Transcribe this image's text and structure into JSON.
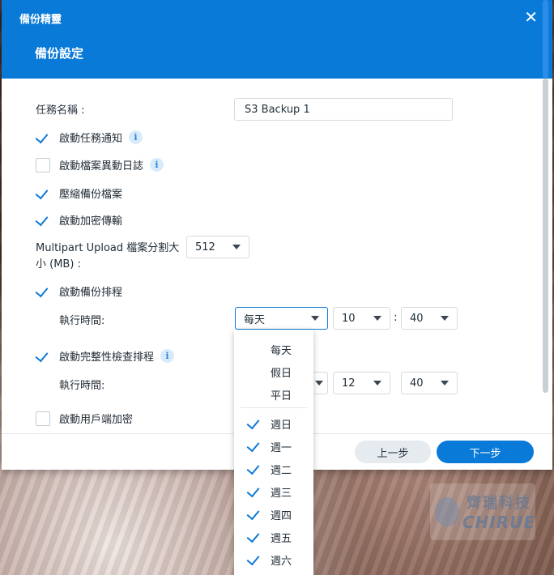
{
  "window": {
    "app_title": "備份精靈",
    "close_glyph": "✕",
    "page_title": "備份設定"
  },
  "form": {
    "task_name_label": "任務名稱 :",
    "task_name_value": "S3 Backup 1",
    "notify_label": "啟動任務通知",
    "file_change_log_label": "啟動檔案異動日誌",
    "compress_label": "壓縮備份檔案",
    "encrypt_transfer_label": "啟動加密傳輸",
    "multipart_label_line1": "Multipart Upload 檔案分割大",
    "multipart_label_line2": "小 (MB) :",
    "multipart_value": "512",
    "backup_schedule_label": "啟動備份排程",
    "backup_exec_time_label": "執行時間:",
    "backup_freq_value": "每天",
    "backup_hour": "10",
    "backup_minute": "40",
    "time_colon": ":",
    "integrity_label": "啟動完整性檢查排程",
    "integrity_exec_time_label": "執行時間:",
    "integrity_hour": "12",
    "integrity_minute": "40",
    "client_encrypt_label": "啟動用戶端加密",
    "info_glyph": "i"
  },
  "checkbox_states": {
    "notify": true,
    "file_change_log": false,
    "compress": true,
    "encrypt_transfer": true,
    "backup_schedule": true,
    "integrity": true,
    "client_encrypt": false
  },
  "dropdown": {
    "options": [
      "每天",
      "假日",
      "平日"
    ],
    "days": [
      "週日",
      "週一",
      "週二",
      "週三",
      "週四",
      "週五",
      "週六"
    ]
  },
  "footer": {
    "prev_label": "上一步",
    "next_label": "下一步"
  },
  "watermark": {
    "cn": "齊瑞科技",
    "en": "CHIRUE"
  },
  "colors": {
    "accent": "#0a7ad8",
    "check": "#0d78d6"
  }
}
